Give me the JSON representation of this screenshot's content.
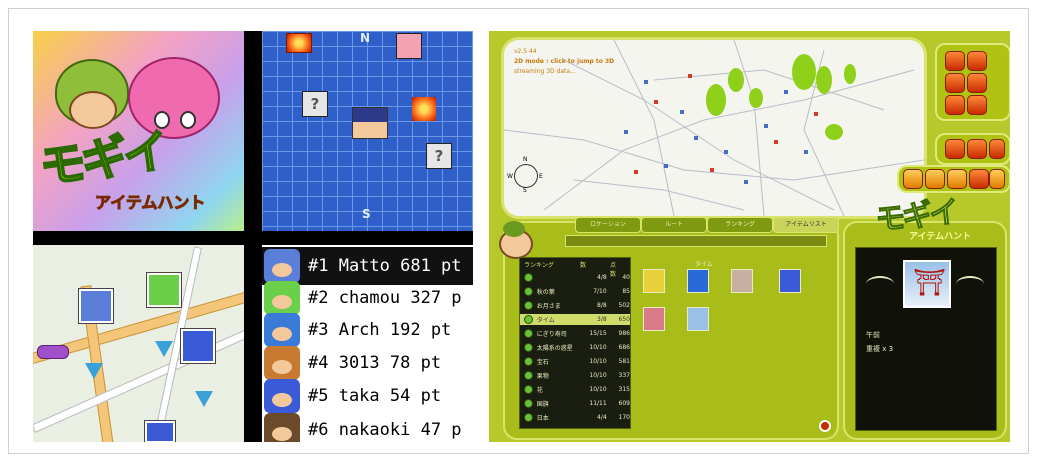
{
  "left_collage": {
    "logo_text": "モギイ",
    "logo_subtitle": "アイテムハント",
    "grid_map": {
      "compass_top": "N",
      "compass_bottom": "S",
      "unknown_tile": "?"
    },
    "leaderboard": [
      {
        "text": "#1 Matto 681 pt",
        "avatar_color": "#5b7fd8"
      },
      {
        "text": "#2 chamou 327 p",
        "avatar_color": "#6ad04a"
      },
      {
        "text": "#3 Arch 192 pt",
        "avatar_color": "#3a7ad8"
      },
      {
        "text": "#4 3013 78 pt",
        "avatar_color": "#c87a30"
      },
      {
        "text": "#5 taka 54 pt",
        "avatar_color": "#3a5ad8"
      },
      {
        "text": "#6 nakaoki 47 p",
        "avatar_color": "#6a4a2a"
      }
    ]
  },
  "right_screen": {
    "map_status": [
      "v2.5 44",
      "2D mode : click to jump to 3D",
      "streaming 3D data..."
    ],
    "compass": [
      "N",
      "S",
      "E",
      "W"
    ],
    "tabs": [
      "ロケーション",
      "ルート",
      "ランキング",
      "アイテムリスト"
    ],
    "list_header": [
      "ランキング",
      "数",
      "点数"
    ],
    "list_rows": [
      {
        "name": "",
        "count": "4/8",
        "points": "40"
      },
      {
        "name": "秋の葉",
        "count": "7/10",
        "points": "85"
      },
      {
        "name": "お月さま",
        "count": "8/8",
        "points": "502"
      },
      {
        "name": "タイム",
        "count": "3/8",
        "points": "650"
      },
      {
        "name": "にぎり寿司",
        "count": "15/15",
        "points": "986"
      },
      {
        "name": "太陽系の惑星",
        "count": "10/10",
        "points": "686"
      },
      {
        "name": "宝石",
        "count": "10/10",
        "points": "581"
      },
      {
        "name": "果物",
        "count": "10/10",
        "points": "337"
      },
      {
        "name": "花",
        "count": "10/10",
        "points": "315"
      },
      {
        "name": "国旗",
        "count": "11/11",
        "points": "609"
      },
      {
        "name": "日本",
        "count": "4/4",
        "points": "170"
      }
    ],
    "selected_row": 3,
    "grid_label": "タイム",
    "info": {
      "logo_text": "モギイ",
      "logo_subtitle": "アイテムハント",
      "line1": "午前",
      "line2": "重複 x 3"
    }
  }
}
